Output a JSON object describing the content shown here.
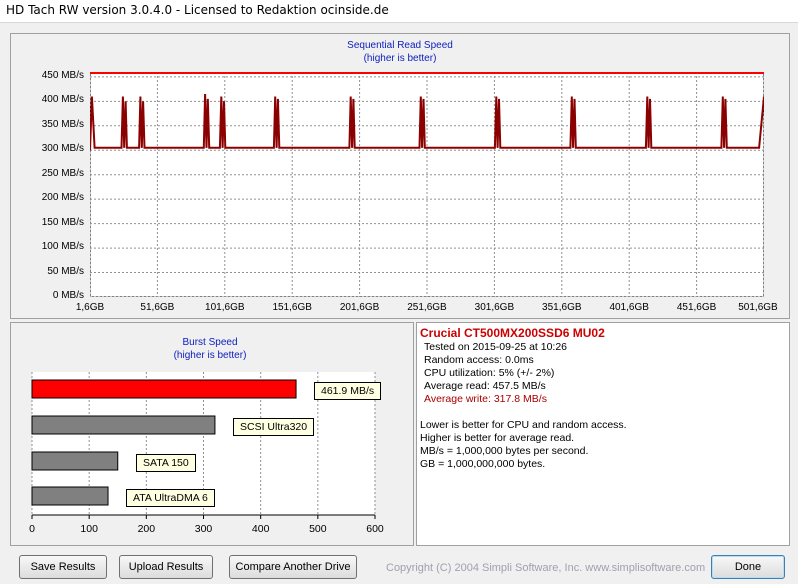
{
  "window": {
    "title": "HD Tach RW version 3.0.4.0 - Licensed to Redaktion ocinside.de"
  },
  "seq_chart": {
    "title": "Sequential Read Speed",
    "subtitle": "(higher is better)",
    "y_ticks": [
      "450 MB/s",
      "400 MB/s",
      "350 MB/s",
      "300 MB/s",
      "250 MB/s",
      "200 MB/s",
      "150 MB/s",
      "100 MB/s",
      "50 MB/s",
      "0 MB/s"
    ],
    "x_ticks": [
      "1,6GB",
      "51,6GB",
      "101,6GB",
      "151,6GB",
      "201,6GB",
      "251,6GB",
      "301,6GB",
      "351,6GB",
      "401,6GB",
      "451,6GB",
      "501,6GB"
    ],
    "colors": {
      "read": "#8b0000",
      "write": "#ff0000",
      "grid": "#808080"
    }
  },
  "chart_data": [
    {
      "type": "line",
      "title": "Sequential Read Speed",
      "subtitle": "(higher is better)",
      "xlabel": "",
      "ylabel": "",
      "ylim": [
        0,
        460
      ],
      "xlim": [
        1.6,
        501.6
      ],
      "grid": true,
      "series": [
        {
          "name": "",
          "color": "#8b0000",
          "x": [
            1.6,
            3,
            5,
            9,
            13,
            17,
            21,
            25,
            26,
            27,
            28,
            29,
            30,
            34,
            38,
            39,
            40,
            41,
            42,
            46,
            50,
            54,
            58,
            62,
            66,
            70,
            74,
            78,
            82,
            86,
            87,
            88,
            89,
            90,
            94,
            98,
            99,
            100,
            101,
            102,
            106,
            110,
            114,
            118,
            122,
            126,
            130,
            134,
            138,
            139,
            140,
            141,
            142,
            146,
            150,
            154,
            158,
            162,
            166,
            170,
            174,
            178,
            182,
            186,
            190,
            194,
            195,
            196,
            197,
            198,
            202,
            206,
            210,
            214,
            218,
            222,
            226,
            230,
            234,
            238,
            242,
            246,
            247,
            248,
            249,
            250,
            254,
            258,
            262,
            266,
            270,
            274,
            278,
            282,
            286,
            290,
            294,
            298,
            302,
            303,
            304,
            305,
            306,
            310,
            314,
            318,
            322,
            326,
            330,
            334,
            338,
            342,
            346,
            350,
            354,
            358,
            359,
            360,
            361,
            362,
            366,
            370,
            374,
            378,
            382,
            386,
            390,
            394,
            398,
            402,
            406,
            410,
            414,
            415,
            416,
            417,
            418,
            422,
            426,
            430,
            434,
            438,
            442,
            446,
            450,
            454,
            458,
            462,
            466,
            470,
            471,
            472,
            473,
            474,
            478,
            482,
            486,
            490,
            494,
            498,
            501.6
          ],
          "y": [
            300,
            410,
            305,
            305,
            305,
            305,
            305,
            305,
            410,
            305,
            400,
            305,
            305,
            305,
            305,
            410,
            305,
            400,
            305,
            305,
            305,
            305,
            305,
            305,
            305,
            305,
            305,
            305,
            305,
            305,
            415,
            305,
            405,
            305,
            305,
            305,
            410,
            305,
            400,
            305,
            305,
            305,
            305,
            305,
            305,
            305,
            305,
            305,
            305,
            410,
            305,
            405,
            305,
            305,
            305,
            305,
            305,
            305,
            305,
            305,
            305,
            305,
            305,
            305,
            305,
            305,
            410,
            305,
            405,
            305,
            305,
            305,
            305,
            305,
            305,
            305,
            305,
            305,
            305,
            305,
            305,
            305,
            410,
            305,
            405,
            305,
            305,
            305,
            305,
            305,
            305,
            305,
            305,
            305,
            305,
            305,
            305,
            305,
            305,
            410,
            305,
            405,
            305,
            305,
            305,
            305,
            305,
            305,
            305,
            305,
            305,
            305,
            305,
            305,
            305,
            305,
            410,
            305,
            405,
            305,
            305,
            305,
            305,
            305,
            305,
            305,
            305,
            305,
            305,
            305,
            305,
            305,
            305,
            410,
            305,
            405,
            305,
            305,
            305,
            305,
            305,
            305,
            305,
            305,
            305,
            305,
            305,
            305,
            305,
            305,
            410,
            305,
            405,
            305,
            305,
            305,
            305,
            305,
            305,
            305,
            410
          ]
        },
        {
          "name": "",
          "color": "#ff0000",
          "x": [
            1.6,
            501.6
          ],
          "y": [
            458,
            458
          ]
        }
      ]
    },
    {
      "type": "bar",
      "title": "Burst Speed",
      "subtitle": "(higher is better)",
      "categories": [
        "461.9 MB/s",
        "SCSI Ultra320",
        "SATA 150",
        "ATA UltraDMA 6"
      ],
      "values": [
        461.9,
        320,
        150,
        133
      ],
      "colors": [
        "#ff0000",
        "#808080",
        "#808080",
        "#808080"
      ],
      "x_ticks": [
        "0",
        "100",
        "200",
        "300",
        "400",
        "500",
        "600"
      ],
      "xlim": [
        0,
        600
      ]
    }
  ],
  "info": {
    "drive_name": "Crucial CT500MX200SSD6 MU02",
    "tested": "Tested on 2015-09-25 at 10:26",
    "random_access": "Random access: 0.0ms",
    "cpu": "CPU utilization: 5% (+/- 2%)",
    "avg_read": "Average read: 457.5 MB/s",
    "avg_write": "Average write: 317.8 MB/s",
    "note1": "Lower is better for CPU and random access.",
    "note2": "Higher is better for average read.",
    "note3": "MB/s = 1,000,000 bytes per second.",
    "note4": "GB = 1,000,000,000 bytes.",
    "colors": {
      "drive_name": "#cc0000",
      "avg_write": "#aa0000"
    }
  },
  "buttons": {
    "save": "Save Results",
    "upload": "Upload Results",
    "compare": "Compare Another Drive",
    "done": "Done"
  },
  "copyright": "Copyright (C) 2004 Simpli Software, Inc. www.simplisoftware.com"
}
